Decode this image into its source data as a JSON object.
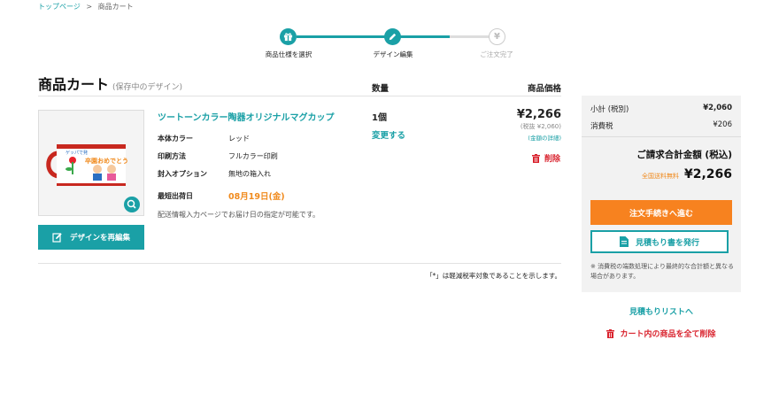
{
  "breadcrumb": {
    "home": "トップページ",
    "separator": ">",
    "current": "商品カート"
  },
  "stepper": [
    {
      "label": "商品仕様を選択",
      "icon": "gift-icon",
      "state": "done"
    },
    {
      "label": "デザイン編集",
      "icon": "pencil-icon",
      "state": "current"
    },
    {
      "label": "ご注文完了",
      "icon": "yen-icon",
      "state": "pending"
    }
  ],
  "cart": {
    "title": "商品カート",
    "subtitle": "(保存中のデザイン)",
    "col_qty": "数量",
    "col_price": "商品価格"
  },
  "item": {
    "name": "ツートーンカラー陶器オリジナルマグカップ",
    "specs": [
      {
        "key": "本体カラー",
        "value": "レッド"
      },
      {
        "key": "印刷方法",
        "value": "フルカラー印刷"
      },
      {
        "key": "封入オプション",
        "value": "無地の箱入れ"
      }
    ],
    "ship_label": "最短出荷日",
    "ship_date": "08月19日(金)",
    "ship_note": "配送情報入力ページでお届け日の指定が可能です。",
    "qty": "1個",
    "change_qty": "変更する",
    "price": "¥2,266",
    "price_ex_tax": "(税抜 ¥2,060)",
    "price_detail": "(金額の詳細)",
    "delete": "削除",
    "edit_design": "デザインを再編集",
    "mug_text_top": "ゲッパで発",
    "mug_text_main": "卒園おめでとう"
  },
  "tax_note": "「*」は軽減税率対象であることを示します。",
  "summary": {
    "subtotal_label": "小計 (税別)",
    "subtotal_value": "¥2,060",
    "tax_label": "消費税",
    "tax_value": "¥206",
    "total_label": "ご請求合計金額 (税込)",
    "free_shipping": "全国送料無料",
    "total_value": "¥2,266",
    "checkout": "注文手続きへ進む",
    "estimate": "見積もり書を発行",
    "note": "※ 消費税の端数処理により最終的な合計額と異なる場合があります。"
  },
  "links": {
    "estimate_list": "見積もりリストへ",
    "clear_cart": "カート内の商品を全て削除"
  },
  "colors": {
    "accent": "#1aa0a6",
    "orange": "#f7821f",
    "danger": "#d9232e"
  }
}
